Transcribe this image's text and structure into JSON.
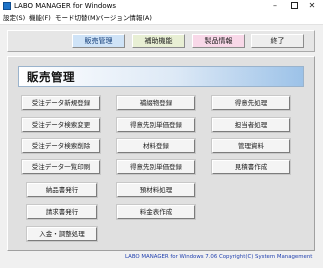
{
  "window": {
    "title": "LABO MANAGER for Windows"
  },
  "caption_buttons": {
    "minimize": "–",
    "close": "✕"
  },
  "menubar": {
    "items": [
      {
        "label": "設定(S)"
      },
      {
        "label": "機能(F)"
      },
      {
        "label": "モード切替(M)"
      },
      {
        "label": "バージョン情報(A)"
      }
    ]
  },
  "toolbar": {
    "buttons": [
      {
        "label": "販売管理"
      },
      {
        "label": "補助機能"
      },
      {
        "label": "製品情報"
      },
      {
        "label": "終了"
      }
    ]
  },
  "panel": {
    "title": "販売管理",
    "col1": [
      {
        "label": "受注データ新規登録"
      },
      {
        "label": "受注データ検索変更"
      },
      {
        "label": "受注データ検索削除"
      },
      {
        "label": "受注データ一覧印刷"
      },
      {
        "label": "納品書発行"
      },
      {
        "label": "請求書発行"
      },
      {
        "label": "入金・調整処理"
      }
    ],
    "col2": [
      {
        "label": "補綴物登録"
      },
      {
        "label": "得意先別単価登録"
      },
      {
        "label": "材料登録"
      },
      {
        "label": "得意先別単価登録"
      },
      {
        "label": "預材料処理"
      },
      {
        "label": "料金表作成"
      }
    ],
    "col3": [
      {
        "label": "得意先処理"
      },
      {
        "label": "担当者処理"
      },
      {
        "label": "管理資料"
      },
      {
        "label": "見積書作成"
      }
    ]
  },
  "status": {
    "text": "LABO MANAGER for Windows 7.06 Copyright(C) System Management"
  }
}
